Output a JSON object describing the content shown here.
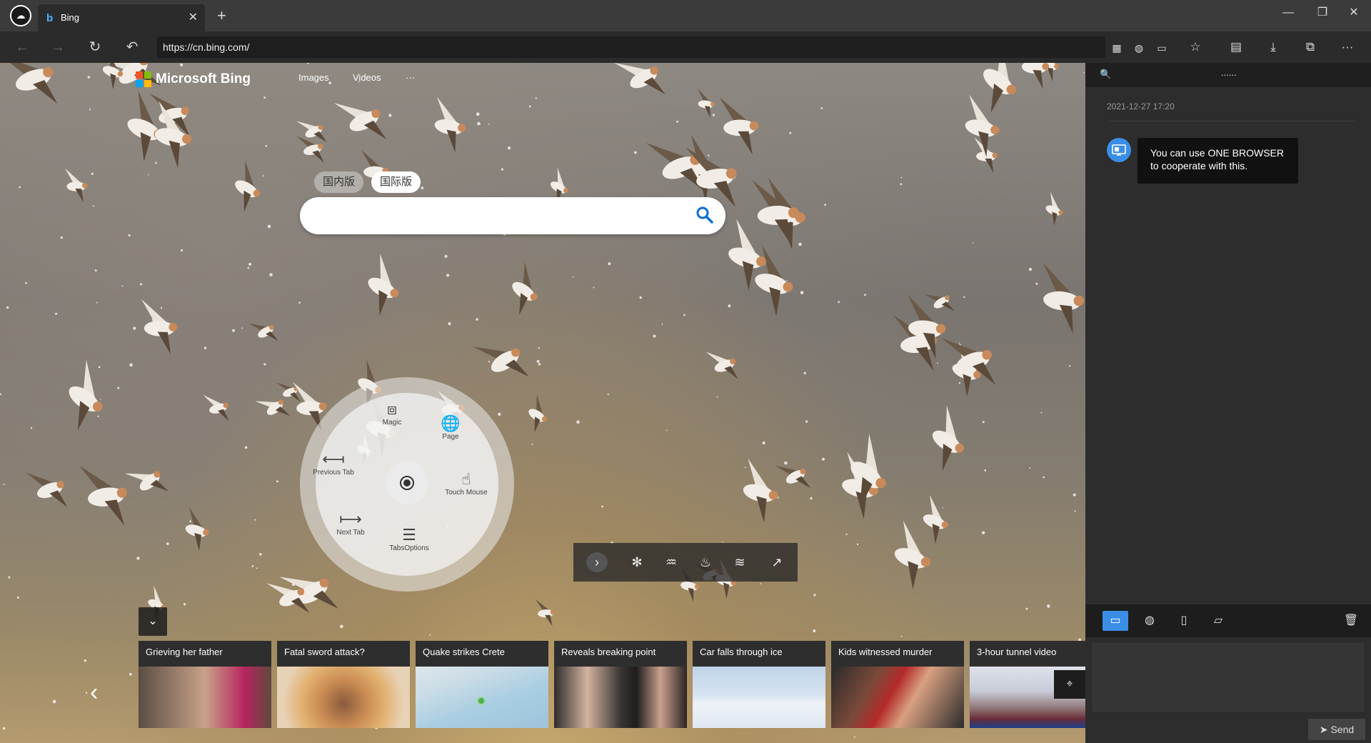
{
  "tab": {
    "favicon": "b",
    "title": "Bing",
    "close": "✕"
  },
  "new_tab": "+",
  "window": {
    "minimize": "—",
    "restore": "❐",
    "close": "✕"
  },
  "address": {
    "url": "https://cn.bing.com/"
  },
  "page": {
    "logo_text": "Microsoft Bing",
    "links": [
      "Images",
      "Videos",
      "···"
    ],
    "region": {
      "domestic": "国内版",
      "international": "国际版"
    },
    "search_placeholder": ""
  },
  "radial_menu": {
    "items": [
      {
        "label": "Magic",
        "icon": "⧈"
      },
      {
        "label": "Page",
        "icon": "🌐"
      },
      {
        "label": "Previous Tab",
        "icon": "⟻"
      },
      {
        "label": "Touch Mouse",
        "icon": "☝"
      },
      {
        "label": "Next Tab",
        "icon": "⟼"
      },
      {
        "label": "TabsOptions",
        "icon": "☰"
      }
    ]
  },
  "news": [
    {
      "title": "Grieving her father"
    },
    {
      "title": "Fatal sword attack?"
    },
    {
      "title": "Quake strikes Crete"
    },
    {
      "title": "Reveals breaking point"
    },
    {
      "title": "Car falls through ice"
    },
    {
      "title": "Kids witnessed murder"
    },
    {
      "title": "3-hour tunnel video"
    }
  ],
  "side_panel": {
    "search_icon": "🔍",
    "dots": "......",
    "timestamp": "2021-12-27 17:20",
    "message": "You can use ONE BROWSER to cooperate with this.",
    "send_label": "Send"
  },
  "colors": {
    "accent": "#3b8ee6",
    "panel": "#2d2d2d",
    "chrome": "#3b3b3b"
  }
}
